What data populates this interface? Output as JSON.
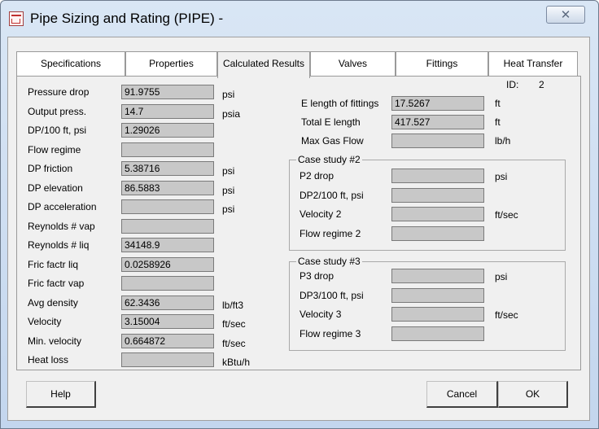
{
  "window": {
    "title": "Pipe Sizing and Rating (PIPE)  -",
    "close_glyph": "✕"
  },
  "tabs": [
    "Specifications",
    "Properties",
    "Calculated Results",
    "Valves",
    "Fittings",
    "Heat Transfer"
  ],
  "active_tab": "Calculated Results",
  "id_label": "ID:",
  "id_value": "2",
  "left_rows": [
    {
      "label": "Pressure drop",
      "value": "91.9755",
      "unit": "psi"
    },
    {
      "label": "Output press.",
      "value": "14.7",
      "unit": "psia"
    },
    {
      "label": "DP/100 ft, psi",
      "value": "1.29026",
      "unit": ""
    },
    {
      "label": "Flow regime",
      "value": "",
      "unit": ""
    },
    {
      "label": "DP friction",
      "value": "5.38716",
      "unit": "psi"
    },
    {
      "label": "DP elevation",
      "value": "86.5883",
      "unit": "psi"
    },
    {
      "label": "DP acceleration",
      "value": "",
      "unit": "psi"
    },
    {
      "label": "Reynolds # vap",
      "value": "",
      "unit": ""
    },
    {
      "label": "Reynolds # liq",
      "value": "34148.9",
      "unit": ""
    },
    {
      "label": "Fric factr liq",
      "value": "0.0258926",
      "unit": ""
    },
    {
      "label": "Fric factr vap",
      "value": "",
      "unit": ""
    },
    {
      "label": "Avg density",
      "value": "62.3436",
      "unit": "lb/ft3"
    },
    {
      "label": "Velocity",
      "value": "3.15004",
      "unit": "ft/sec"
    },
    {
      "label": "Min. velocity",
      "value": "0.664872",
      "unit": "ft/sec"
    },
    {
      "label": "Heat loss",
      "value": "",
      "unit": "kBtu/h"
    }
  ],
  "right_top": [
    {
      "label": "E length of fittings",
      "value": "17.5267",
      "unit": "ft"
    },
    {
      "label": "Total E length",
      "value": "417.527",
      "unit": "ft"
    },
    {
      "label": "Max Gas Flow",
      "value": "",
      "unit": "lb/h"
    }
  ],
  "case2": {
    "title": "Case study #2",
    "rows": [
      {
        "label": "P2 drop",
        "value": "",
        "unit": "psi"
      },
      {
        "label": "DP2/100 ft, psi",
        "value": "",
        "unit": ""
      },
      {
        "label": "Velocity 2",
        "value": "",
        "unit": "ft/sec"
      },
      {
        "label": "Flow regime 2",
        "value": "",
        "unit": ""
      }
    ]
  },
  "case3": {
    "title": "Case study #3",
    "rows": [
      {
        "label": "P3 drop",
        "value": "",
        "unit": "psi"
      },
      {
        "label": "DP3/100 ft, psi",
        "value": "",
        "unit": ""
      },
      {
        "label": "Velocity 3",
        "value": "",
        "unit": "ft/sec"
      },
      {
        "label": "Flow regime 3",
        "value": "",
        "unit": ""
      }
    ]
  },
  "buttons": {
    "help": "Help",
    "cancel": "Cancel",
    "ok": "OK"
  }
}
